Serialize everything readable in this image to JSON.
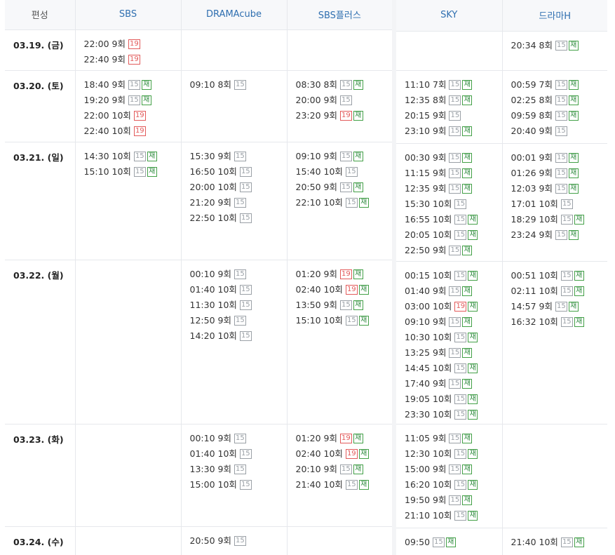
{
  "header": {
    "label": "편성",
    "channels_a": [
      "SBS",
      "DRAMAcube",
      "SBS플러스"
    ],
    "channels_b": [
      "SKY",
      "드라마H"
    ]
  },
  "dates": [
    "03.19. (금)",
    "03.20. (토)",
    "03.21. (일)",
    "03.22. (월)",
    "03.23. (화)",
    "03.24. (수)"
  ],
  "badge_text": {
    "b15": "15",
    "b19": "19",
    "re": "재"
  },
  "schedule": [
    [
      [
        {
          "time": "22:00",
          "ep": "9회",
          "r": "19",
          "re": false
        },
        {
          "time": "22:40",
          "ep": "9회",
          "r": "19",
          "re": false
        }
      ],
      [],
      [],
      [],
      [
        {
          "time": "20:34",
          "ep": "8회",
          "r": "15",
          "re": true
        }
      ]
    ],
    [
      [
        {
          "time": "18:40",
          "ep": "9회",
          "r": "15",
          "re": true
        },
        {
          "time": "19:20",
          "ep": "9회",
          "r": "15",
          "re": true
        },
        {
          "time": "22:00",
          "ep": "10회",
          "r": "19",
          "re": false
        },
        {
          "time": "22:40",
          "ep": "10회",
          "r": "19",
          "re": false
        }
      ],
      [
        {
          "time": "09:10",
          "ep": "8회",
          "r": "15",
          "re": false
        }
      ],
      [
        {
          "time": "08:30",
          "ep": "8회",
          "r": "15",
          "re": true
        },
        {
          "time": "20:00",
          "ep": "9회",
          "r": "15",
          "re": false
        },
        {
          "time": "23:20",
          "ep": "9회",
          "r": "19",
          "re": true
        }
      ],
      [
        {
          "time": "11:10",
          "ep": "7회",
          "r": "15",
          "re": true
        },
        {
          "time": "12:35",
          "ep": "8회",
          "r": "15",
          "re": true
        },
        {
          "time": "20:15",
          "ep": "9회",
          "r": "15",
          "re": false
        },
        {
          "time": "23:10",
          "ep": "9회",
          "r": "15",
          "re": true
        }
      ],
      [
        {
          "time": "00:59",
          "ep": "7회",
          "r": "15",
          "re": true
        },
        {
          "time": "02:25",
          "ep": "8회",
          "r": "15",
          "re": true
        },
        {
          "time": "09:59",
          "ep": "8회",
          "r": "15",
          "re": true
        },
        {
          "time": "20:40",
          "ep": "9회",
          "r": "15",
          "re": false
        }
      ]
    ],
    [
      [
        {
          "time": "14:30",
          "ep": "10회",
          "r": "15",
          "re": true
        },
        {
          "time": "15:10",
          "ep": "10회",
          "r": "15",
          "re": true
        }
      ],
      [
        {
          "time": "15:30",
          "ep": "9회",
          "r": "15",
          "re": false
        },
        {
          "time": "16:50",
          "ep": "10회",
          "r": "15",
          "re": false
        },
        {
          "time": "20:00",
          "ep": "10회",
          "r": "15",
          "re": false
        },
        {
          "time": "21:20",
          "ep": "9회",
          "r": "15",
          "re": false
        },
        {
          "time": "22:50",
          "ep": "10회",
          "r": "15",
          "re": false
        }
      ],
      [
        {
          "time": "09:10",
          "ep": "9회",
          "r": "15",
          "re": true
        },
        {
          "time": "15:40",
          "ep": "10회",
          "r": "15",
          "re": false
        },
        {
          "time": "20:50",
          "ep": "9회",
          "r": "15",
          "re": true
        },
        {
          "time": "22:10",
          "ep": "10회",
          "r": "15",
          "re": true
        }
      ],
      [
        {
          "time": "00:30",
          "ep": "9회",
          "r": "15",
          "re": true
        },
        {
          "time": "11:15",
          "ep": "9회",
          "r": "15",
          "re": true
        },
        {
          "time": "12:35",
          "ep": "9회",
          "r": "15",
          "re": true
        },
        {
          "time": "15:30",
          "ep": "10회",
          "r": "15",
          "re": false
        },
        {
          "time": "16:55",
          "ep": "10회",
          "r": "15",
          "re": true
        },
        {
          "time": "20:05",
          "ep": "10회",
          "r": "15",
          "re": true
        },
        {
          "time": "22:50",
          "ep": "9회",
          "r": "15",
          "re": true
        }
      ],
      [
        {
          "time": "00:01",
          "ep": "9회",
          "r": "15",
          "re": true
        },
        {
          "time": "01:26",
          "ep": "9회",
          "r": "15",
          "re": true
        },
        {
          "time": "12:03",
          "ep": "9회",
          "r": "15",
          "re": true
        },
        {
          "time": "17:01",
          "ep": "10회",
          "r": "15",
          "re": false
        },
        {
          "time": "18:29",
          "ep": "10회",
          "r": "15",
          "re": true
        },
        {
          "time": "23:24",
          "ep": "9회",
          "r": "15",
          "re": true
        }
      ]
    ],
    [
      [],
      [
        {
          "time": "00:10",
          "ep": "9회",
          "r": "15",
          "re": false
        },
        {
          "time": "01:40",
          "ep": "10회",
          "r": "15",
          "re": false
        },
        {
          "time": "11:30",
          "ep": "10회",
          "r": "15",
          "re": false
        },
        {
          "time": "12:50",
          "ep": "9회",
          "r": "15",
          "re": false
        },
        {
          "time": "14:20",
          "ep": "10회",
          "r": "15",
          "re": false
        }
      ],
      [
        {
          "time": "01:20",
          "ep": "9회",
          "r": "19",
          "re": true
        },
        {
          "time": "02:40",
          "ep": "10회",
          "r": "19",
          "re": true
        },
        {
          "time": "13:50",
          "ep": "9회",
          "r": "15",
          "re": true
        },
        {
          "time": "15:10",
          "ep": "10회",
          "r": "15",
          "re": true
        }
      ],
      [
        {
          "time": "00:15",
          "ep": "10회",
          "r": "15",
          "re": true
        },
        {
          "time": "01:40",
          "ep": "9회",
          "r": "15",
          "re": true
        },
        {
          "time": "03:00",
          "ep": "10회",
          "r": "19",
          "re": true
        },
        {
          "time": "09:10",
          "ep": "9회",
          "r": "15",
          "re": true
        },
        {
          "time": "10:30",
          "ep": "10회",
          "r": "15",
          "re": true
        },
        {
          "time": "13:25",
          "ep": "9회",
          "r": "15",
          "re": true
        },
        {
          "time": "14:45",
          "ep": "10회",
          "r": "15",
          "re": true
        },
        {
          "time": "17:40",
          "ep": "9회",
          "r": "15",
          "re": true
        },
        {
          "time": "19:05",
          "ep": "10회",
          "r": "15",
          "re": true
        },
        {
          "time": "23:30",
          "ep": "10회",
          "r": "15",
          "re": true
        }
      ],
      [
        {
          "time": "00:51",
          "ep": "10회",
          "r": "15",
          "re": true
        },
        {
          "time": "02:11",
          "ep": "10회",
          "r": "15",
          "re": true
        },
        {
          "time": "14:57",
          "ep": "9회",
          "r": "15",
          "re": true
        },
        {
          "time": "16:32",
          "ep": "10회",
          "r": "15",
          "re": true
        }
      ]
    ],
    [
      [],
      [
        {
          "time": "00:10",
          "ep": "9회",
          "r": "15",
          "re": false
        },
        {
          "time": "01:40",
          "ep": "10회",
          "r": "15",
          "re": false
        },
        {
          "time": "13:30",
          "ep": "9회",
          "r": "15",
          "re": false
        },
        {
          "time": "15:00",
          "ep": "10회",
          "r": "15",
          "re": false
        }
      ],
      [
        {
          "time": "01:20",
          "ep": "9회",
          "r": "19",
          "re": true
        },
        {
          "time": "02:40",
          "ep": "10회",
          "r": "19",
          "re": true
        },
        {
          "time": "20:10",
          "ep": "9회",
          "r": "15",
          "re": true
        },
        {
          "time": "21:40",
          "ep": "10회",
          "r": "15",
          "re": true
        }
      ],
      [
        {
          "time": "11:05",
          "ep": "9회",
          "r": "15",
          "re": true
        },
        {
          "time": "12:30",
          "ep": "10회",
          "r": "15",
          "re": true
        },
        {
          "time": "15:00",
          "ep": "9회",
          "r": "15",
          "re": true
        },
        {
          "time": "16:20",
          "ep": "10회",
          "r": "15",
          "re": true
        },
        {
          "time": "19:50",
          "ep": "9회",
          "r": "15",
          "re": true
        },
        {
          "time": "21:10",
          "ep": "10회",
          "r": "15",
          "re": true
        }
      ],
      []
    ],
    [
      [],
      [
        {
          "time": "20:50",
          "ep": "9회",
          "r": "15",
          "re": false
        }
      ],
      [],
      [
        {
          "time": "09:50",
          "ep": "",
          "r": "15",
          "re": true
        }
      ],
      [
        {
          "time": "21:40",
          "ep": "10회",
          "r": "15",
          "re": true
        }
      ]
    ]
  ]
}
